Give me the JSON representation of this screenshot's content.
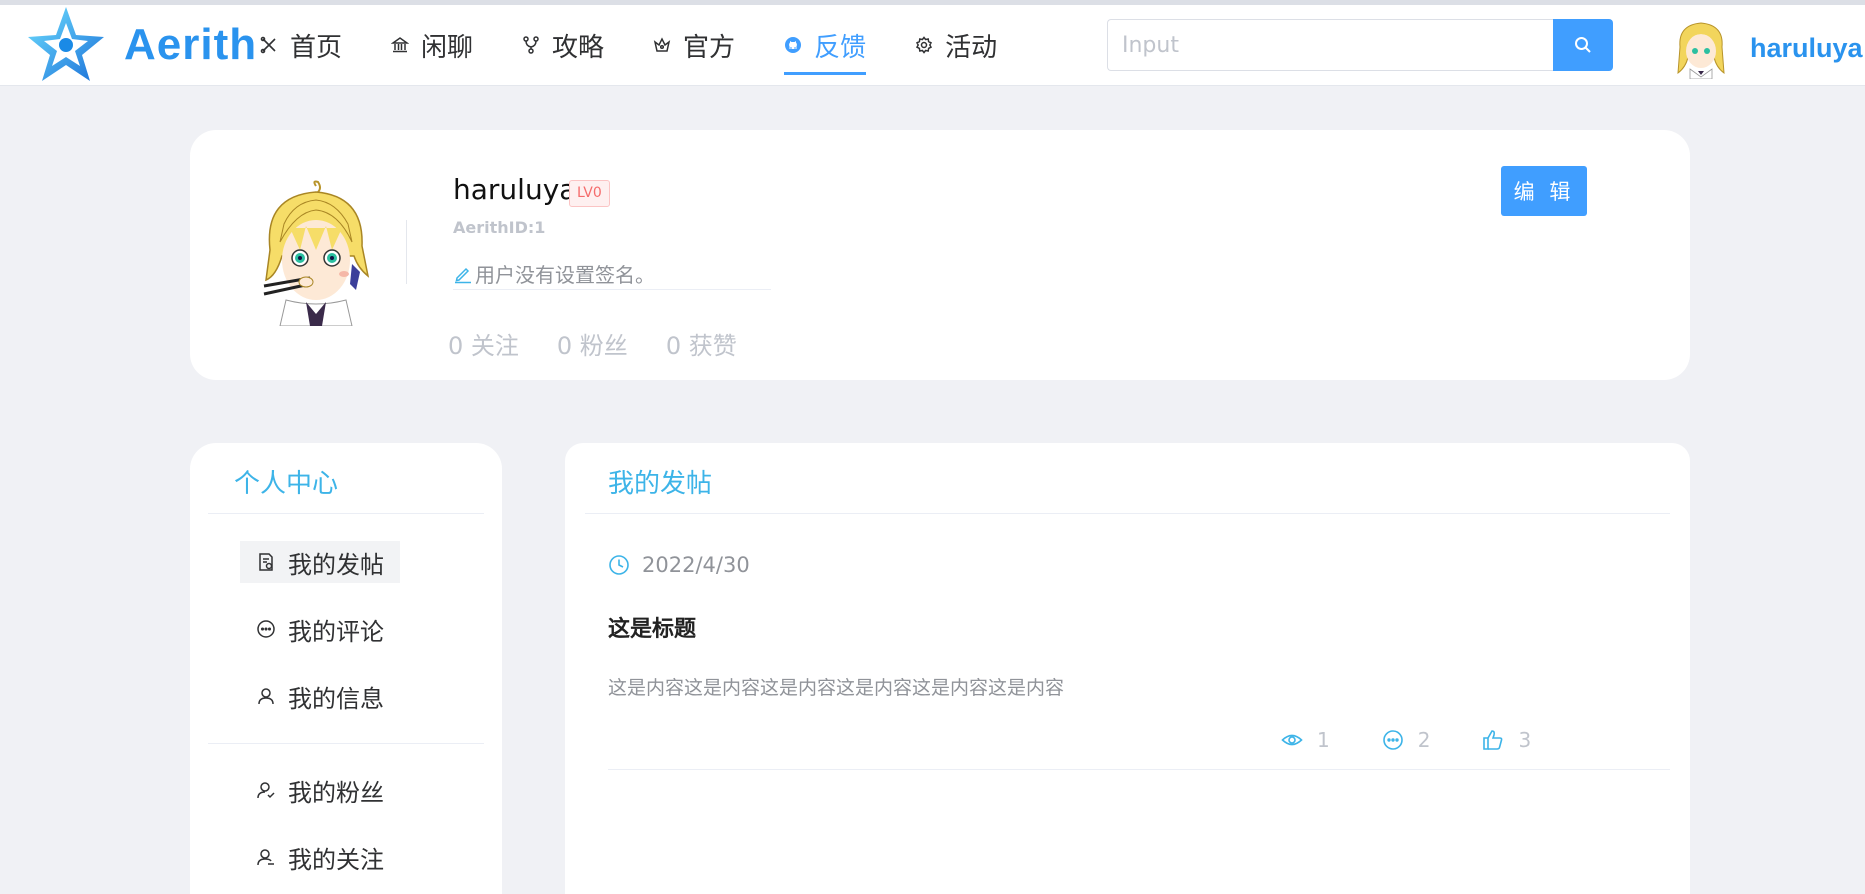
{
  "header": {
    "logo_text": "Aerith",
    "nav": [
      {
        "label": "首页",
        "icon": "scissors-icon",
        "active": false
      },
      {
        "label": "闲聊",
        "icon": "bank-icon",
        "active": false
      },
      {
        "label": "攻略",
        "icon": "branch-icon",
        "active": false
      },
      {
        "label": "官方",
        "icon": "crown-icon",
        "active": false
      },
      {
        "label": "反馈",
        "icon": "github-icon",
        "active": true
      },
      {
        "label": "活动",
        "icon": "gear-icon",
        "active": false
      }
    ],
    "search": {
      "placeholder": "Input",
      "value": ""
    },
    "username": "haruluya"
  },
  "profile": {
    "name": "haruluya",
    "level": "LV0",
    "aerith_id": "AerithID:1",
    "signature": "用户没有设置签名。",
    "stats": {
      "following": "0 关注",
      "fans": "0 粉丝",
      "likes": "0 获赞"
    },
    "edit_label": "编 辑"
  },
  "sidebar": {
    "title": "个人中心",
    "items": [
      {
        "label": "我的发帖",
        "icon": "document-icon",
        "active": true
      },
      {
        "label": "我的评论",
        "icon": "comment-icon",
        "active": false
      },
      {
        "label": "我的信息",
        "icon": "user-icon",
        "active": false
      },
      {
        "label": "我的粉丝",
        "icon": "user-fans-icon",
        "active": false
      },
      {
        "label": "我的关注",
        "icon": "user-follow-icon",
        "active": false
      }
    ]
  },
  "posts": {
    "title": "我的发帖",
    "items": [
      {
        "date": "2022/4/30",
        "title": "这是标题",
        "content": "这是内容这是内容这是内容这是内容这是内容这是内容",
        "views": "1",
        "comments": "2",
        "likes": "3"
      }
    ]
  },
  "colors": {
    "accent": "#409eff",
    "title_blue": "#3db4e8",
    "logo_blue": "#2a93ee",
    "background": "#f0f1f5"
  }
}
